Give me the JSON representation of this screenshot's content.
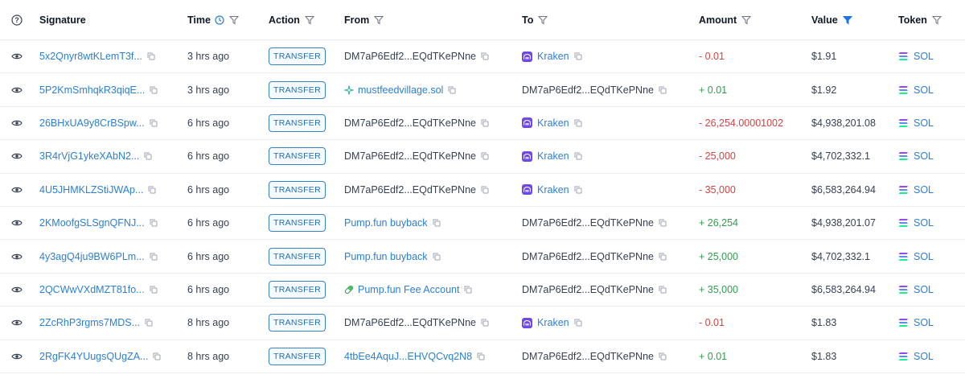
{
  "header": {
    "signature": "Signature",
    "time": "Time",
    "action": "Action",
    "from": "From",
    "to": "To",
    "amount": "Amount",
    "value": "Value",
    "token": "Token"
  },
  "colors": {
    "link": "#2b7fd6",
    "negative": "#d14343",
    "positive": "#2e9e4f",
    "active_filter": "#1a73e8"
  },
  "rows": [
    {
      "signature": "5x2Qnyr8wtKLemT3f...",
      "time": "3 hrs ago",
      "action": "TRANSFER",
      "from": "DM7aP6Edf2...EQdTKePNne",
      "from_icon": "",
      "from_link": false,
      "to": "Kraken",
      "to_icon": "kraken-icon",
      "to_link": true,
      "amount": "- 0.01",
      "sign": "neg",
      "value": "$1.91",
      "token": "SOL"
    },
    {
      "signature": "5P2KmSmhqkR3qiqE...",
      "time": "3 hrs ago",
      "action": "TRANSFER",
      "from": "mustfeedvillage.sol",
      "from_icon": "sparkle-icon",
      "from_link": true,
      "to": "DM7aP6Edf2...EQdTKePNne",
      "to_icon": "",
      "to_link": false,
      "amount": "+ 0.01",
      "sign": "pos",
      "value": "$1.92",
      "token": "SOL"
    },
    {
      "signature": "26BHxUA9y8CrBSpw...",
      "time": "6 hrs ago",
      "action": "TRANSFER",
      "from": "DM7aP6Edf2...EQdTKePNne",
      "from_icon": "",
      "from_link": false,
      "to": "Kraken",
      "to_icon": "kraken-icon",
      "to_link": true,
      "amount": "- 26,254.00001002",
      "sign": "neg",
      "value": "$4,938,201.08",
      "token": "SOL"
    },
    {
      "signature": "3R4rVjG1ykeXAbN2...",
      "time": "6 hrs ago",
      "action": "TRANSFER",
      "from": "DM7aP6Edf2...EQdTKePNne",
      "from_icon": "",
      "from_link": false,
      "to": "Kraken",
      "to_icon": "kraken-icon",
      "to_link": true,
      "amount": "- 25,000",
      "sign": "neg",
      "value": "$4,702,332.1",
      "token": "SOL"
    },
    {
      "signature": "4U5JHMKLZStiJWAp...",
      "time": "6 hrs ago",
      "action": "TRANSFER",
      "from": "DM7aP6Edf2...EQdTKePNne",
      "from_icon": "",
      "from_link": false,
      "to": "Kraken",
      "to_icon": "kraken-icon",
      "to_link": true,
      "amount": "- 35,000",
      "sign": "neg",
      "value": "$6,583,264.94",
      "token": "SOL"
    },
    {
      "signature": "2KMoofgSLSgnQFNJ...",
      "time": "6 hrs ago",
      "action": "TRANSFER",
      "from": "Pump.fun buyback",
      "from_icon": "",
      "from_link": true,
      "to": "DM7aP6Edf2...EQdTKePNne",
      "to_icon": "",
      "to_link": false,
      "amount": "+ 26,254",
      "sign": "pos",
      "value": "$4,938,201.07",
      "token": "SOL"
    },
    {
      "signature": "4y3agQ4ju9BW6PLm...",
      "time": "6 hrs ago",
      "action": "TRANSFER",
      "from": "Pump.fun buyback",
      "from_icon": "",
      "from_link": true,
      "to": "DM7aP6Edf2...EQdTKePNne",
      "to_icon": "",
      "to_link": false,
      "amount": "+ 25,000",
      "sign": "pos",
      "value": "$4,702,332.1",
      "token": "SOL"
    },
    {
      "signature": "2QCWwVXdMZT81fo...",
      "time": "6 hrs ago",
      "action": "TRANSFER",
      "from": "Pump.fun Fee Account",
      "from_icon": "pill-icon",
      "from_link": true,
      "to": "DM7aP6Edf2...EQdTKePNne",
      "to_icon": "",
      "to_link": false,
      "amount": "+ 35,000",
      "sign": "pos",
      "value": "$6,583,264.94",
      "token": "SOL"
    },
    {
      "signature": "2ZcRhP3rgms7MDS...",
      "time": "8 hrs ago",
      "action": "TRANSFER",
      "from": "DM7aP6Edf2...EQdTKePNne",
      "from_icon": "",
      "from_link": false,
      "to": "Kraken",
      "to_icon": "kraken-icon",
      "to_link": true,
      "amount": "- 0.01",
      "sign": "neg",
      "value": "$1.83",
      "token": "SOL"
    },
    {
      "signature": "2RgFK4YUugsQUgZA...",
      "time": "8 hrs ago",
      "action": "TRANSFER",
      "from": "4tbEe4AquJ...EHVQCvq2N8",
      "from_icon": "",
      "from_link": true,
      "to": "DM7aP6Edf2...EQdTKePNne",
      "to_icon": "",
      "to_link": false,
      "amount": "+ 0.01",
      "sign": "pos",
      "value": "$1.83",
      "token": "SOL"
    }
  ]
}
